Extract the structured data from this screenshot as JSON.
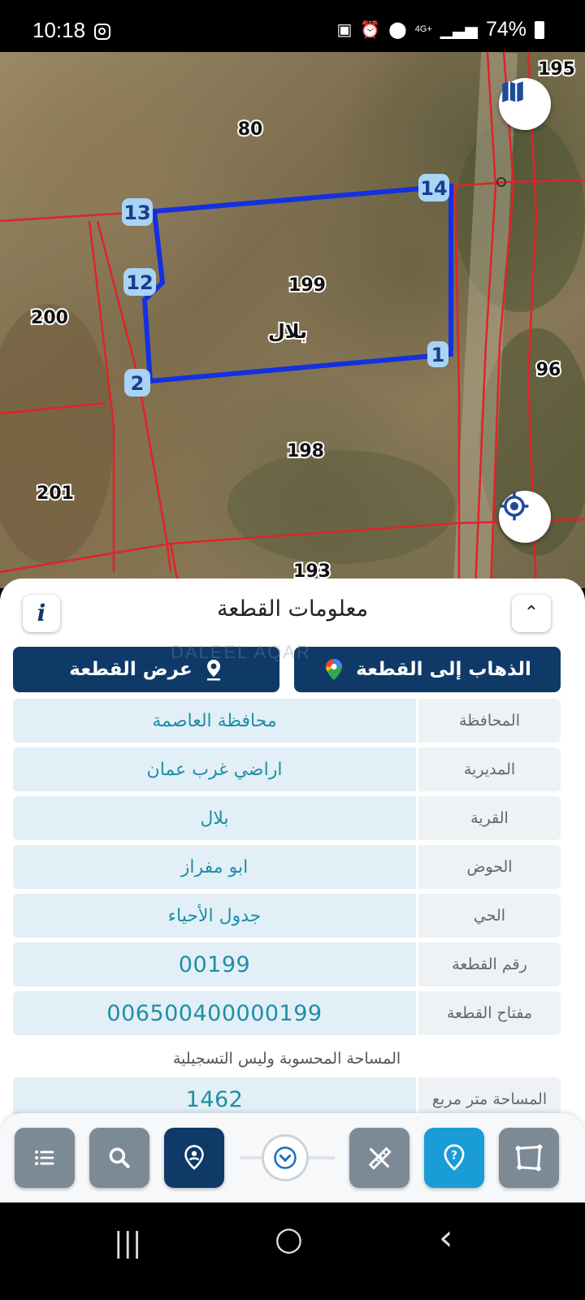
{
  "status_bar": {
    "time": "10:18",
    "network": "4G+",
    "battery": "74%"
  },
  "map": {
    "parcel_labels": [
      "195",
      "80",
      "199",
      "200",
      "96",
      "198",
      "201",
      "193"
    ],
    "village_label": "بلال",
    "vertex_labels": [
      "13",
      "14",
      "12",
      "2",
      "1"
    ],
    "boundary_color": "#1430e0",
    "parcel_line_color": "#e0232a",
    "vertex_badge_color": "#a9d4f5",
    "icons": [
      "map-layers-icon",
      "locate-icon"
    ]
  },
  "sheet": {
    "title": "معلومات القطعة",
    "info_symbol": "i",
    "collapse_symbol": "⌃",
    "watermark": "DALEEL AQAR",
    "show_parcel_label": "عرض القطعة",
    "go_to_parcel_label": "الذهاب إلى القطعة",
    "rows": [
      {
        "label": "المحافظة",
        "value": "محافظة العاصمة"
      },
      {
        "label": "المديرية",
        "value": "اراضي غرب عمان"
      },
      {
        "label": "القرية",
        "value": "بلال"
      },
      {
        "label": "الحوض",
        "value": "ابو مفراز"
      },
      {
        "label": "الحي",
        "value": "جدول الأحياء"
      },
      {
        "label": "رقم القطعة",
        "value": "00199"
      },
      {
        "label": "مفتاح القطعة",
        "value": "006500400000199"
      }
    ],
    "area_note": "المساحة المحسوبة وليس التسجيلية",
    "area_row": {
      "label": "المساحة متر مربع",
      "value": "1462"
    }
  },
  "toolbar": {
    "buttons": [
      "list-icon",
      "search-icon",
      "location-pin-icon",
      "expand-chevron-icon",
      "measure-tool-icon",
      "help-icon",
      "polygon-icon"
    ],
    "colors": {
      "gray": "#7c8a96",
      "navy": "#0f3a68",
      "cyan": "#1a9cd6"
    }
  },
  "nav_bar": {
    "recents": "|||",
    "home": "○",
    "back": "‹"
  }
}
